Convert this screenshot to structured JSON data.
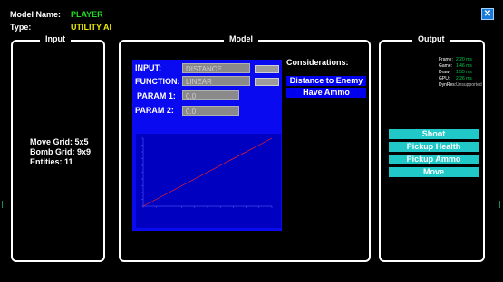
{
  "header": {
    "model_name_label": "Model Name:",
    "model_name_value": "PLAYER",
    "type_label": "Type:",
    "type_value": "UTILITY AI",
    "model_name_color": "#22dd22",
    "type_color": "#e8e800",
    "close_icon": "close-icon"
  },
  "input_panel": {
    "title": "Input",
    "stats": [
      "Move Grid: 5x5",
      "Bomb Grid: 9x9",
      "Entities: 11"
    ]
  },
  "model_panel": {
    "title": "Model",
    "input_label": "INPUT:",
    "input_value": "DISTANCE",
    "function_label": "FUNCTION:",
    "function_value": "LINEAR",
    "param1_label": "PARAM 1:",
    "param1_value": "0.0",
    "param2_label": "PARAM 2:",
    "param2_value": "0.0",
    "considerations_label": "Considerations:",
    "considerations": [
      "Distance to Enemy",
      "Have Ammo"
    ]
  },
  "output_panel": {
    "title": "Output",
    "perf": [
      {
        "key": "Frame:",
        "value": "2.20 ms"
      },
      {
        "key": "Game:",
        "value": "1.46 ms"
      },
      {
        "key": "Draw:",
        "value": "1.55 ms"
      },
      {
        "key": "GPU:",
        "value": "2.26 ms"
      },
      {
        "key": "DynRes:",
        "value": "Unsupported"
      }
    ],
    "actions": [
      "Shoot",
      "Pickup Health",
      "Pickup Ammo",
      "Move"
    ]
  },
  "chart_data": {
    "type": "line",
    "series": [
      {
        "x": [
          0,
          1
        ],
        "y": [
          0,
          1
        ]
      }
    ],
    "xlim": [
      0,
      1
    ],
    "ylim": [
      0,
      1
    ],
    "line_color": "#ff2020"
  }
}
